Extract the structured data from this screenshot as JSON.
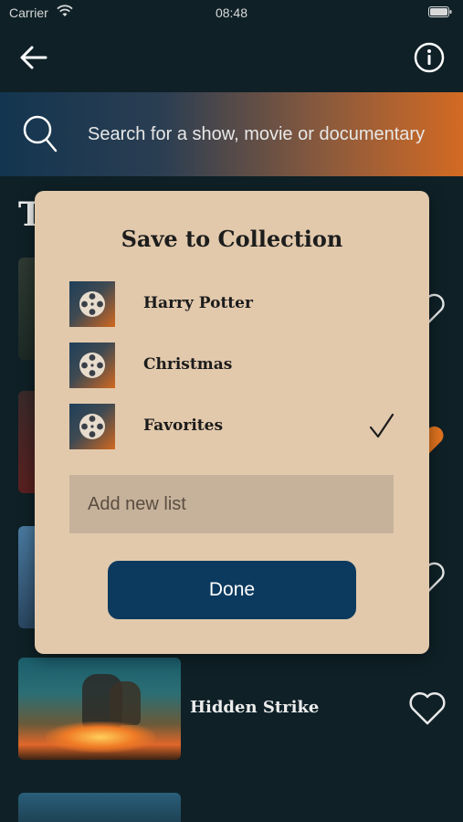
{
  "status_bar": {
    "carrier": "Carrier",
    "time": "08:48"
  },
  "nav": {
    "back_icon": "arrow-left-icon",
    "info_icon": "info-circle-icon"
  },
  "search": {
    "placeholder": "Search for a show, movie or documentary",
    "icon": "search-icon"
  },
  "background": {
    "section_title_peek": "T",
    "list_item": {
      "title": "Hidden Strike",
      "favorited": false
    }
  },
  "modal": {
    "title": "Save to Collection",
    "collections": [
      {
        "name": "Harry Potter",
        "selected": false
      },
      {
        "name": "Christmas",
        "selected": false
      },
      {
        "name": "Favorites",
        "selected": true
      }
    ],
    "new_list_placeholder": "Add new list",
    "done_label": "Done"
  },
  "colors": {
    "background": "#0f2127",
    "modal": "#e2c9ac",
    "input": "#c6b29b",
    "button": "#0c3a5e",
    "accent": "#e2741f"
  }
}
